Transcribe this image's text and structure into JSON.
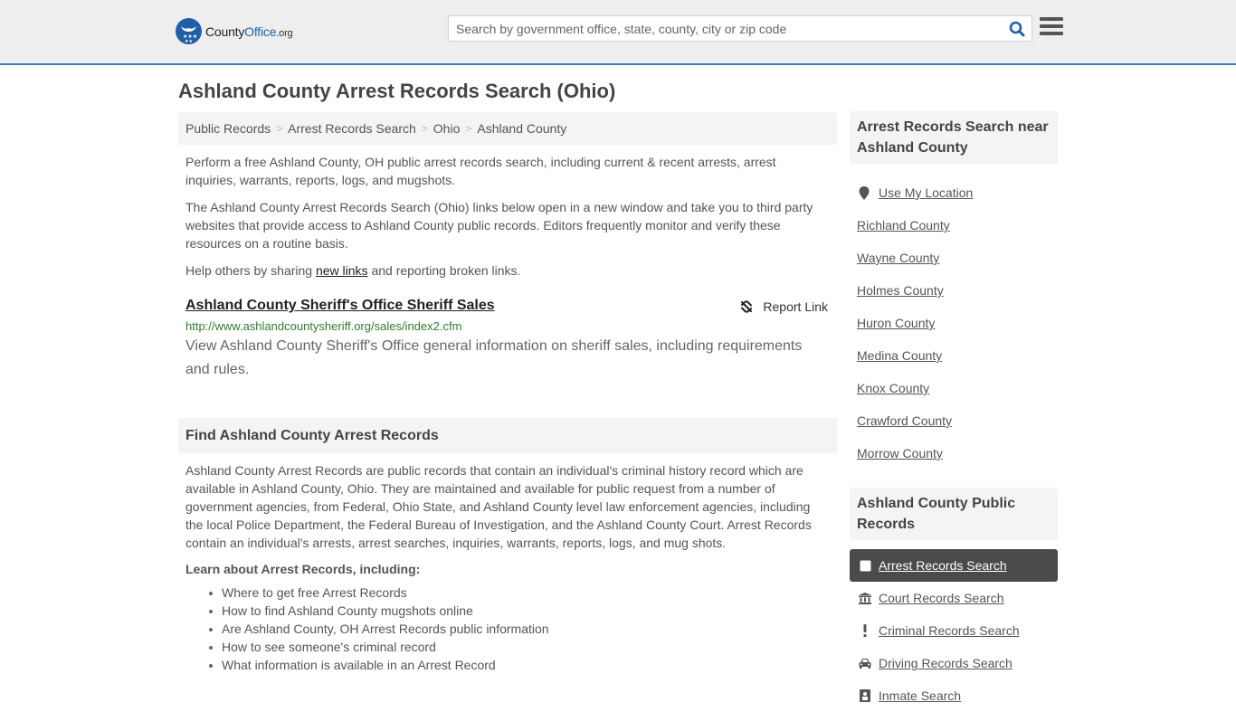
{
  "header": {
    "logo": {
      "brand_part1": "County",
      "brand_part2": "Office",
      "brand_tld": ".org"
    },
    "search": {
      "placeholder": "Search by government office, state, county, city or zip code",
      "value": ""
    },
    "icons": {
      "search": "search-icon",
      "menu": "hamburger-menu-icon"
    }
  },
  "page_title": "Ashland County Arrest Records Search (Ohio)",
  "breadcrumb": [
    "Public Records",
    "Arrest Records Search",
    "Ohio",
    "Ashland County"
  ],
  "intro": {
    "p1": "Perform a free Ashland County, OH public arrest records search, including current & recent arrests, arrest inquiries, warrants, reports, logs, and mugshots.",
    "p2": "The Ashland County Arrest Records Search (Ohio) links below open in a new window and take you to third party websites that provide access to Ashland County public records. Editors frequently monitor and verify these resources on a routine basis.",
    "p3_before": "Help others by sharing ",
    "p3_link": "new links",
    "p3_after": " and reporting broken links."
  },
  "result": {
    "title": "Ashland County Sheriff's Office Sheriff Sales",
    "url": "http://www.ashlandcountysheriff.org/sales/index2.cfm",
    "description": "View Ashland County Sheriff's Office general information on sheriff sales, including requirements and rules.",
    "report_label": "Report Link"
  },
  "find_section": {
    "heading": "Find Ashland County Arrest Records",
    "body": "Ashland County Arrest Records are public records that contain an individual's criminal history record which are available in Ashland County, Ohio. They are maintained and available for public request from a number of government agencies, from Federal, Ohio State, and Ashland County level law enforcement agencies, including the local Police Department, the Federal Bureau of Investigation, and the Ashland County Court. Arrest Records contain an individual's arrests, arrest searches, inquiries, warrants, reports, logs, and mug shots.",
    "learn_heading": "Learn about Arrest Records, including:",
    "learn_items": [
      "Where to get free Arrest Records",
      "How to find Ashland County mugshots online",
      "Are Ashland County, OH Arrest Records public information",
      "How to see someone's criminal record",
      "What information is available in an Arrest Record"
    ]
  },
  "sidebar": {
    "nearby_heading": "Arrest Records Search near Ashland County",
    "use_location": "Use My Location",
    "nearby": [
      "Richland County",
      "Wayne County",
      "Holmes County",
      "Huron County",
      "Medina County",
      "Knox County",
      "Crawford County",
      "Morrow County"
    ],
    "public_heading": "Ashland County Public Records",
    "records": [
      {
        "label": "Arrest Records Search",
        "icon": "square-icon",
        "active": true
      },
      {
        "label": "Court Records Search",
        "icon": "courthouse-icon",
        "active": false
      },
      {
        "label": "Criminal Records Search",
        "icon": "exclamation-icon",
        "active": false
      },
      {
        "label": "Driving Records Search",
        "icon": "car-icon",
        "active": false
      },
      {
        "label": "Inmate Search",
        "icon": "inmate-icon",
        "active": false
      }
    ]
  },
  "colors": {
    "accent": "#3a7fb5",
    "brand_blue": "#1e5fa8",
    "url_green": "#2e7d32",
    "active_bg": "#4a4a4a"
  }
}
